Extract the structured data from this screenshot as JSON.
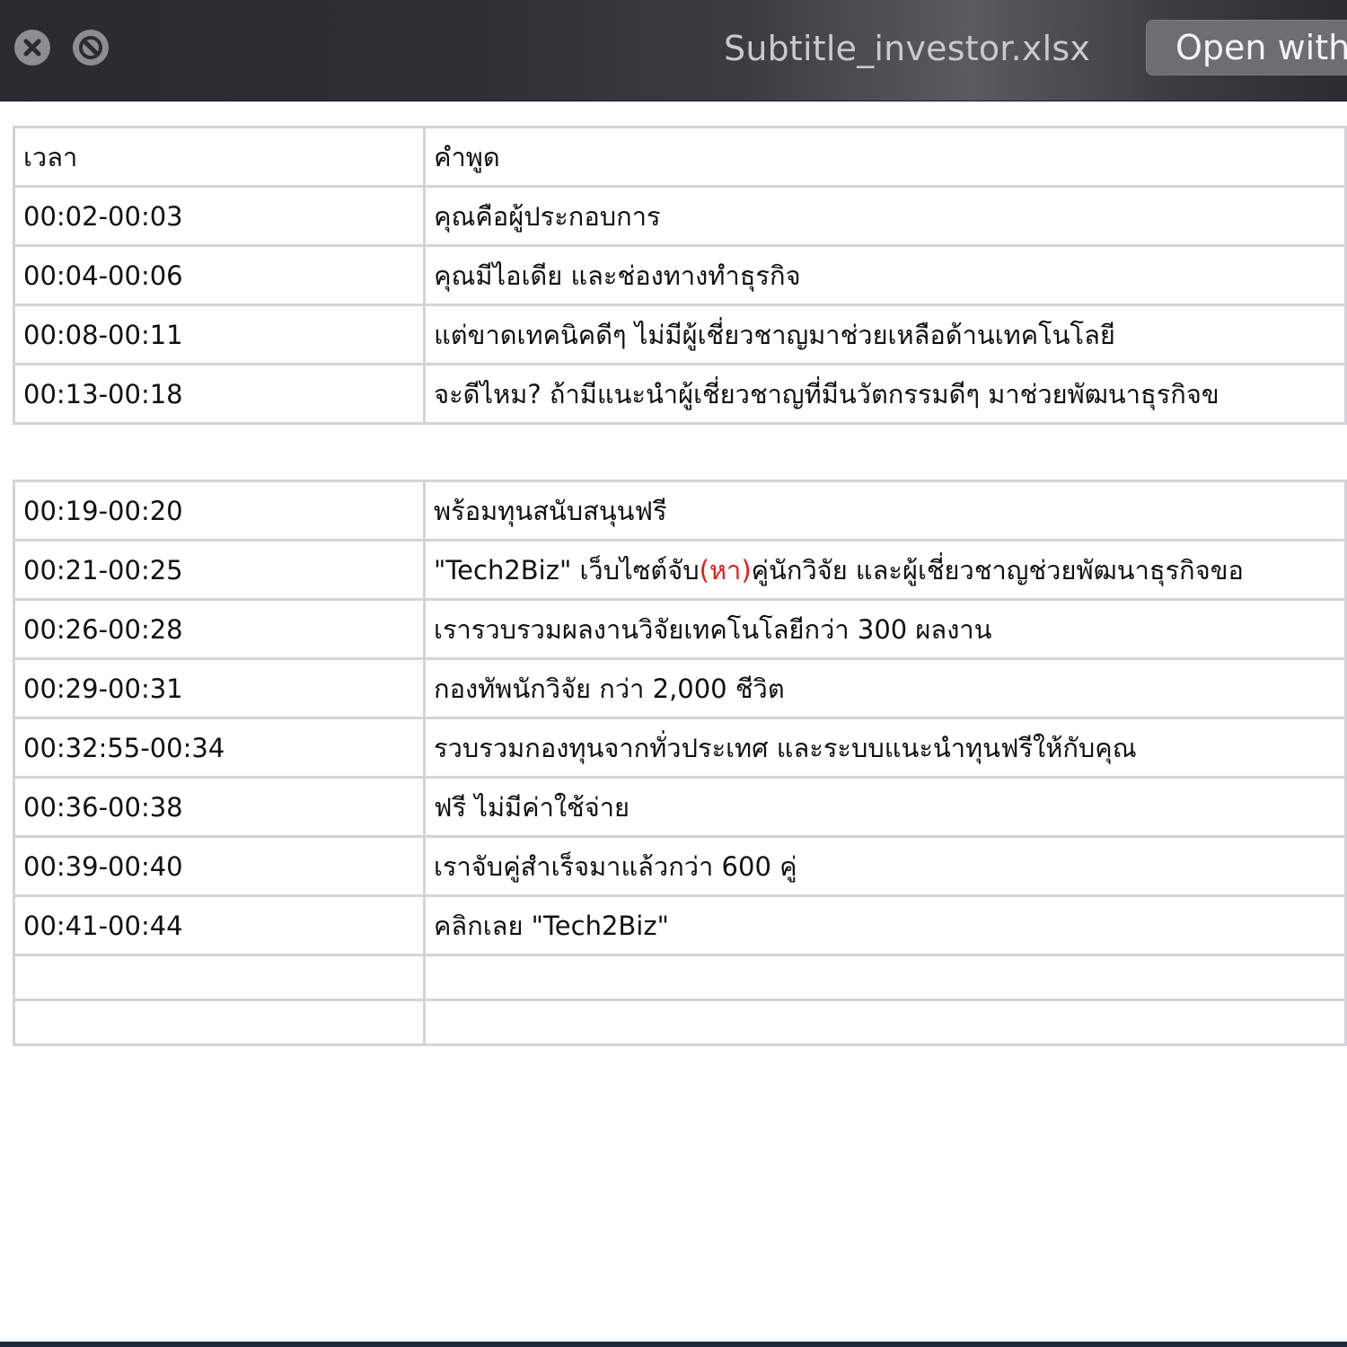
{
  "window": {
    "title": "Subtitle_investor.xlsx",
    "open_with_label": "Open with",
    "close_icon": "close-icon",
    "no_fullscreen_icon": "no-fullscreen-icon"
  },
  "sheet": {
    "header": {
      "time": "เวลา",
      "speech": "คำพูด"
    },
    "table1": [
      {
        "time": "00:02-00:03",
        "speech": "คุณคือผู้ประกอบการ"
      },
      {
        "time": "00:04-00:06",
        "speech": "คุณมีไอเดีย และช่องทางทำธุรกิจ"
      },
      {
        "time": "00:08-00:11",
        "speech": "แต่ขาดเทคนิคดีๆ ไม่มีผู้เชี่ยวชาญมาช่วยเหลือด้านเทคโนโลยี"
      },
      {
        "time": "00:13-00:18",
        "speech": "จะดีไหม? ถ้ามีแนะนำผู้เชี่ยวชาญที่มีนวัตกรรมดีๆ มาช่วยพัฒนาธุรกิจข"
      }
    ],
    "table2": [
      {
        "time": "00:19-00:20",
        "speech": "พร้อมทุนสนับสนุนฟรี"
      },
      {
        "time": "00:21-00:25",
        "speech_before": "\"Tech2Biz\" เว็บไซต์จับ",
        "speech_highlight": "(หา)",
        "speech_after": "คู่นักวิจัย และผู้เชี่ยวชาญช่วยพัฒนาธุรกิจขอ"
      },
      {
        "time": "00:26-00:28",
        "speech": "เรารวบรวมผลงานวิจัยเทคโนโลยีกว่า 300 ผลงาน"
      },
      {
        "time": "00:29-00:31",
        "speech": "กองทัพนักวิจัย กว่า 2,000 ชีวิต"
      },
      {
        "time": "00:32:55-00:34",
        "speech": "รวบรวมกองทุนจากทั่วประเทศ และระบบแนะนำทุนฟรีให้กับคุณ"
      },
      {
        "time": "00:36-00:38",
        "speech": "ฟรี ไม่มีค่าใช้จ่าย"
      },
      {
        "time": "00:39-00:40",
        "speech": "เราจับคู่สำเร็จมาแล้วกว่า 600 คู่"
      },
      {
        "time": "00:41-00:44",
        "speech": "คลิกเลย \"Tech2Biz\""
      }
    ]
  },
  "colors": {
    "highlight_red": "#e0201b",
    "grid": "#d3d4da",
    "titlebar": "#2f3034"
  }
}
